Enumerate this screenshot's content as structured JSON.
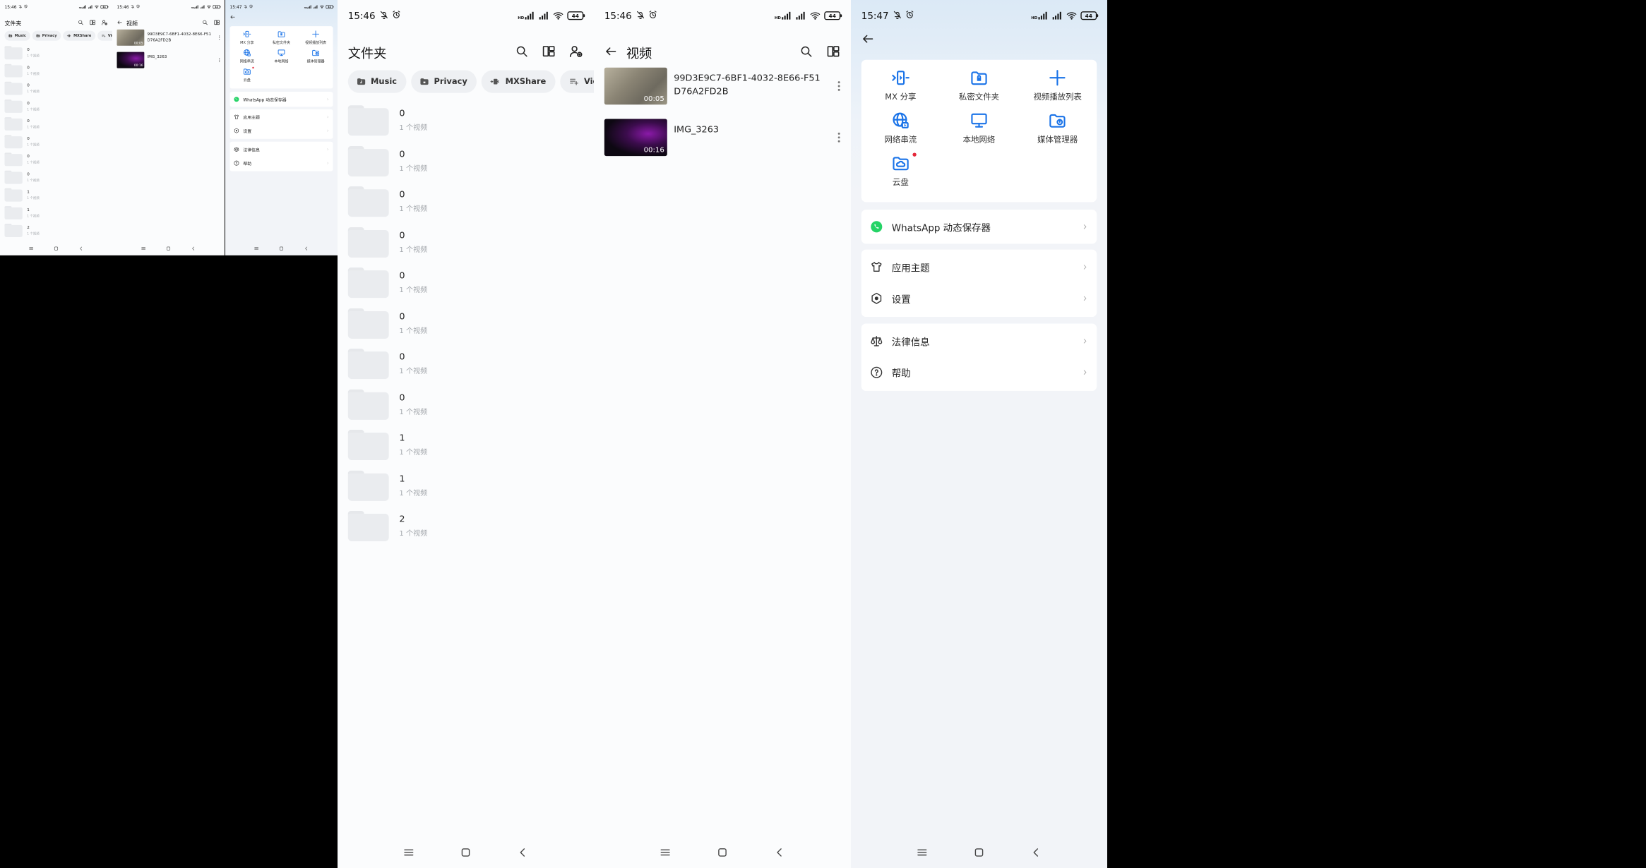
{
  "status": {
    "time_1546": "15:46",
    "time_1547": "15:47",
    "battery": "44",
    "network_tag": "HD"
  },
  "folders_screen": {
    "title": "文件夹",
    "chips": [
      {
        "label": "Music",
        "icon": "music-folder-icon"
      },
      {
        "label": "Privacy",
        "icon": "lock-folder-icon"
      },
      {
        "label": "MXShare",
        "icon": "mxshare-icon"
      },
      {
        "label": "Video",
        "icon": "playlist-icon"
      }
    ],
    "folders": [
      {
        "name": "0",
        "sub": "1 个视频"
      },
      {
        "name": "0",
        "sub": "1 个视频"
      },
      {
        "name": "0",
        "sub": "1 个视频"
      },
      {
        "name": "0",
        "sub": "1 个视频"
      },
      {
        "name": "0",
        "sub": "1 个视频"
      },
      {
        "name": "0",
        "sub": "1 个视频"
      },
      {
        "name": "0",
        "sub": "1 个视频"
      },
      {
        "name": "0",
        "sub": "1 个视频"
      },
      {
        "name": "1",
        "sub": "1 个视频"
      },
      {
        "name": "1",
        "sub": "1 个视频"
      },
      {
        "name": "2",
        "sub": "1 个视频"
      }
    ]
  },
  "videos_screen": {
    "title": "视频",
    "videos": [
      {
        "title": "99D3E9C7-6BF1-4032-8E66-F51D76A2FD2B",
        "duration": "00:05"
      },
      {
        "title": "IMG_3263",
        "duration": "00:16"
      }
    ]
  },
  "settings_screen": {
    "grid": [
      {
        "label": "MX 分享",
        "icon": "mx-share-icon"
      },
      {
        "label": "私密文件夹",
        "icon": "private-folder-icon"
      },
      {
        "label": "视频播放列表",
        "icon": "plus-icon"
      },
      {
        "label": "网络串流",
        "icon": "globe-icon"
      },
      {
        "label": "本地网络",
        "icon": "monitor-icon"
      },
      {
        "label": "媒体管理器",
        "icon": "media-manager-icon"
      },
      {
        "label": "云盘",
        "icon": "cloud-folder-icon"
      }
    ],
    "whatsapp": "WhatsApp 动态保存器",
    "theme": "应用主题",
    "settings": "设置",
    "legal": "法律信息",
    "help": "帮助"
  },
  "colors": {
    "accent": "#1a73e8",
    "whatsapp": "#25d366",
    "badge": "#e5293a"
  }
}
